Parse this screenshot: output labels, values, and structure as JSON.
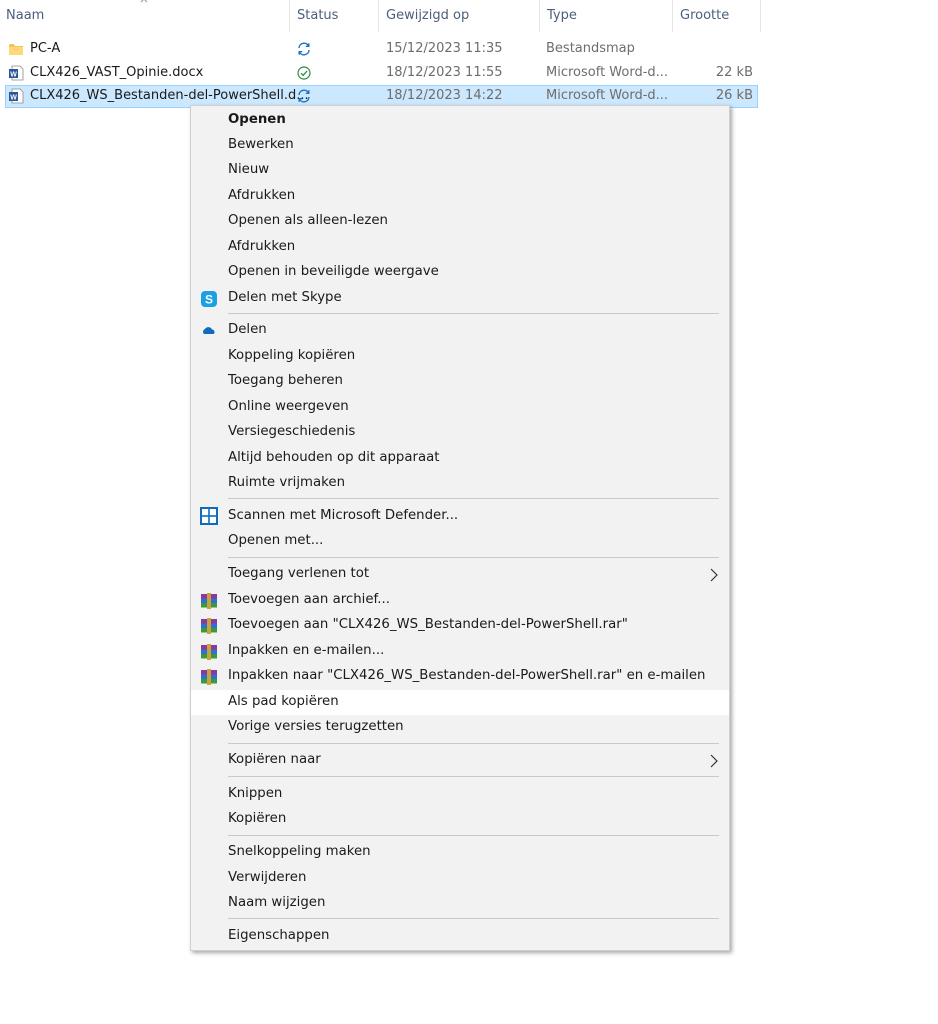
{
  "header": {
    "columns": [
      {
        "label": "Naam"
      },
      {
        "label": "Status"
      },
      {
        "label": "Gewijzigd op"
      },
      {
        "label": "Type"
      },
      {
        "label": "Grootte"
      }
    ]
  },
  "files": [
    {
      "name": "PC-A",
      "status_icon": "sync-icon",
      "modified": "15/12/2023 11:35",
      "type": "Bestandsmap",
      "size": "",
      "icon": "folder-icon"
    },
    {
      "name": "CLX426_VAST_Opinie.docx",
      "status_icon": "synced-check-icon",
      "modified": "18/12/2023 11:55",
      "type": "Microsoft Word-d...",
      "size": "22 kB",
      "icon": "word-document-icon"
    },
    {
      "name": "CLX426_WS_Bestanden-del-PowerShell.d...",
      "status_icon": "sync-icon",
      "modified": "18/12/2023 14:22",
      "type": "Microsoft Word-d...",
      "size": "26 kB",
      "icon": "word-document-icon",
      "selected": true
    }
  ],
  "menu": {
    "items": [
      {
        "label": "Openen"
      },
      {
        "label": "Bewerken"
      },
      {
        "label": "Nieuw"
      },
      {
        "label": "Afdrukken"
      },
      {
        "label": "Openen als alleen-lezen"
      },
      {
        "label": "Afdrukken"
      },
      {
        "label": "Openen in beveiligde weergave"
      },
      {
        "label": "Delen met Skype",
        "icon": "skype-icon"
      },
      {
        "label": "Delen",
        "icon": "onedrive-cloud-icon"
      },
      {
        "label": "Koppeling kopiëren"
      },
      {
        "label": "Toegang beheren"
      },
      {
        "label": "Online weergeven"
      },
      {
        "label": "Versiegeschiedenis"
      },
      {
        "label": "Altijd behouden op dit apparaat"
      },
      {
        "label": "Ruimte vrijmaken"
      },
      {
        "label": "Scannen met Microsoft Defender...",
        "icon": "defender-shield-icon"
      },
      {
        "label": "Openen met..."
      },
      {
        "label": "Toegang verlenen tot",
        "submenu": true
      },
      {
        "label": "Toevoegen aan archief...",
        "icon": "winrar-icon"
      },
      {
        "label": "Toevoegen aan \"CLX426_WS_Bestanden-del-PowerShell.rar\"",
        "icon": "winrar-icon"
      },
      {
        "label": "Inpakken en e-mailen...",
        "icon": "winrar-icon"
      },
      {
        "label": "Inpakken naar \"CLX426_WS_Bestanden-del-PowerShell.rar\" en e-mailen",
        "icon": "winrar-icon"
      },
      {
        "label": "Als pad kopiëren",
        "highlighted": true
      },
      {
        "label": "Vorige versies terugzetten"
      },
      {
        "label": "Kopiëren naar",
        "submenu": true
      },
      {
        "label": "Knippen"
      },
      {
        "label": "Kopiëren"
      },
      {
        "label": "Snelkoppeling maken"
      },
      {
        "label": "Verwijderen"
      },
      {
        "label": "Naam wijzigen"
      },
      {
        "label": "Eigenschappen"
      }
    ]
  },
  "colors": {
    "selection_bg": "#cce8ff",
    "selection_border": "#99d1ff",
    "menu_bg": "#f2f2f2",
    "menu_highlight": "#ffffff",
    "sync_blue": "#1a73c7",
    "synced_green": "#2e8b3a"
  }
}
